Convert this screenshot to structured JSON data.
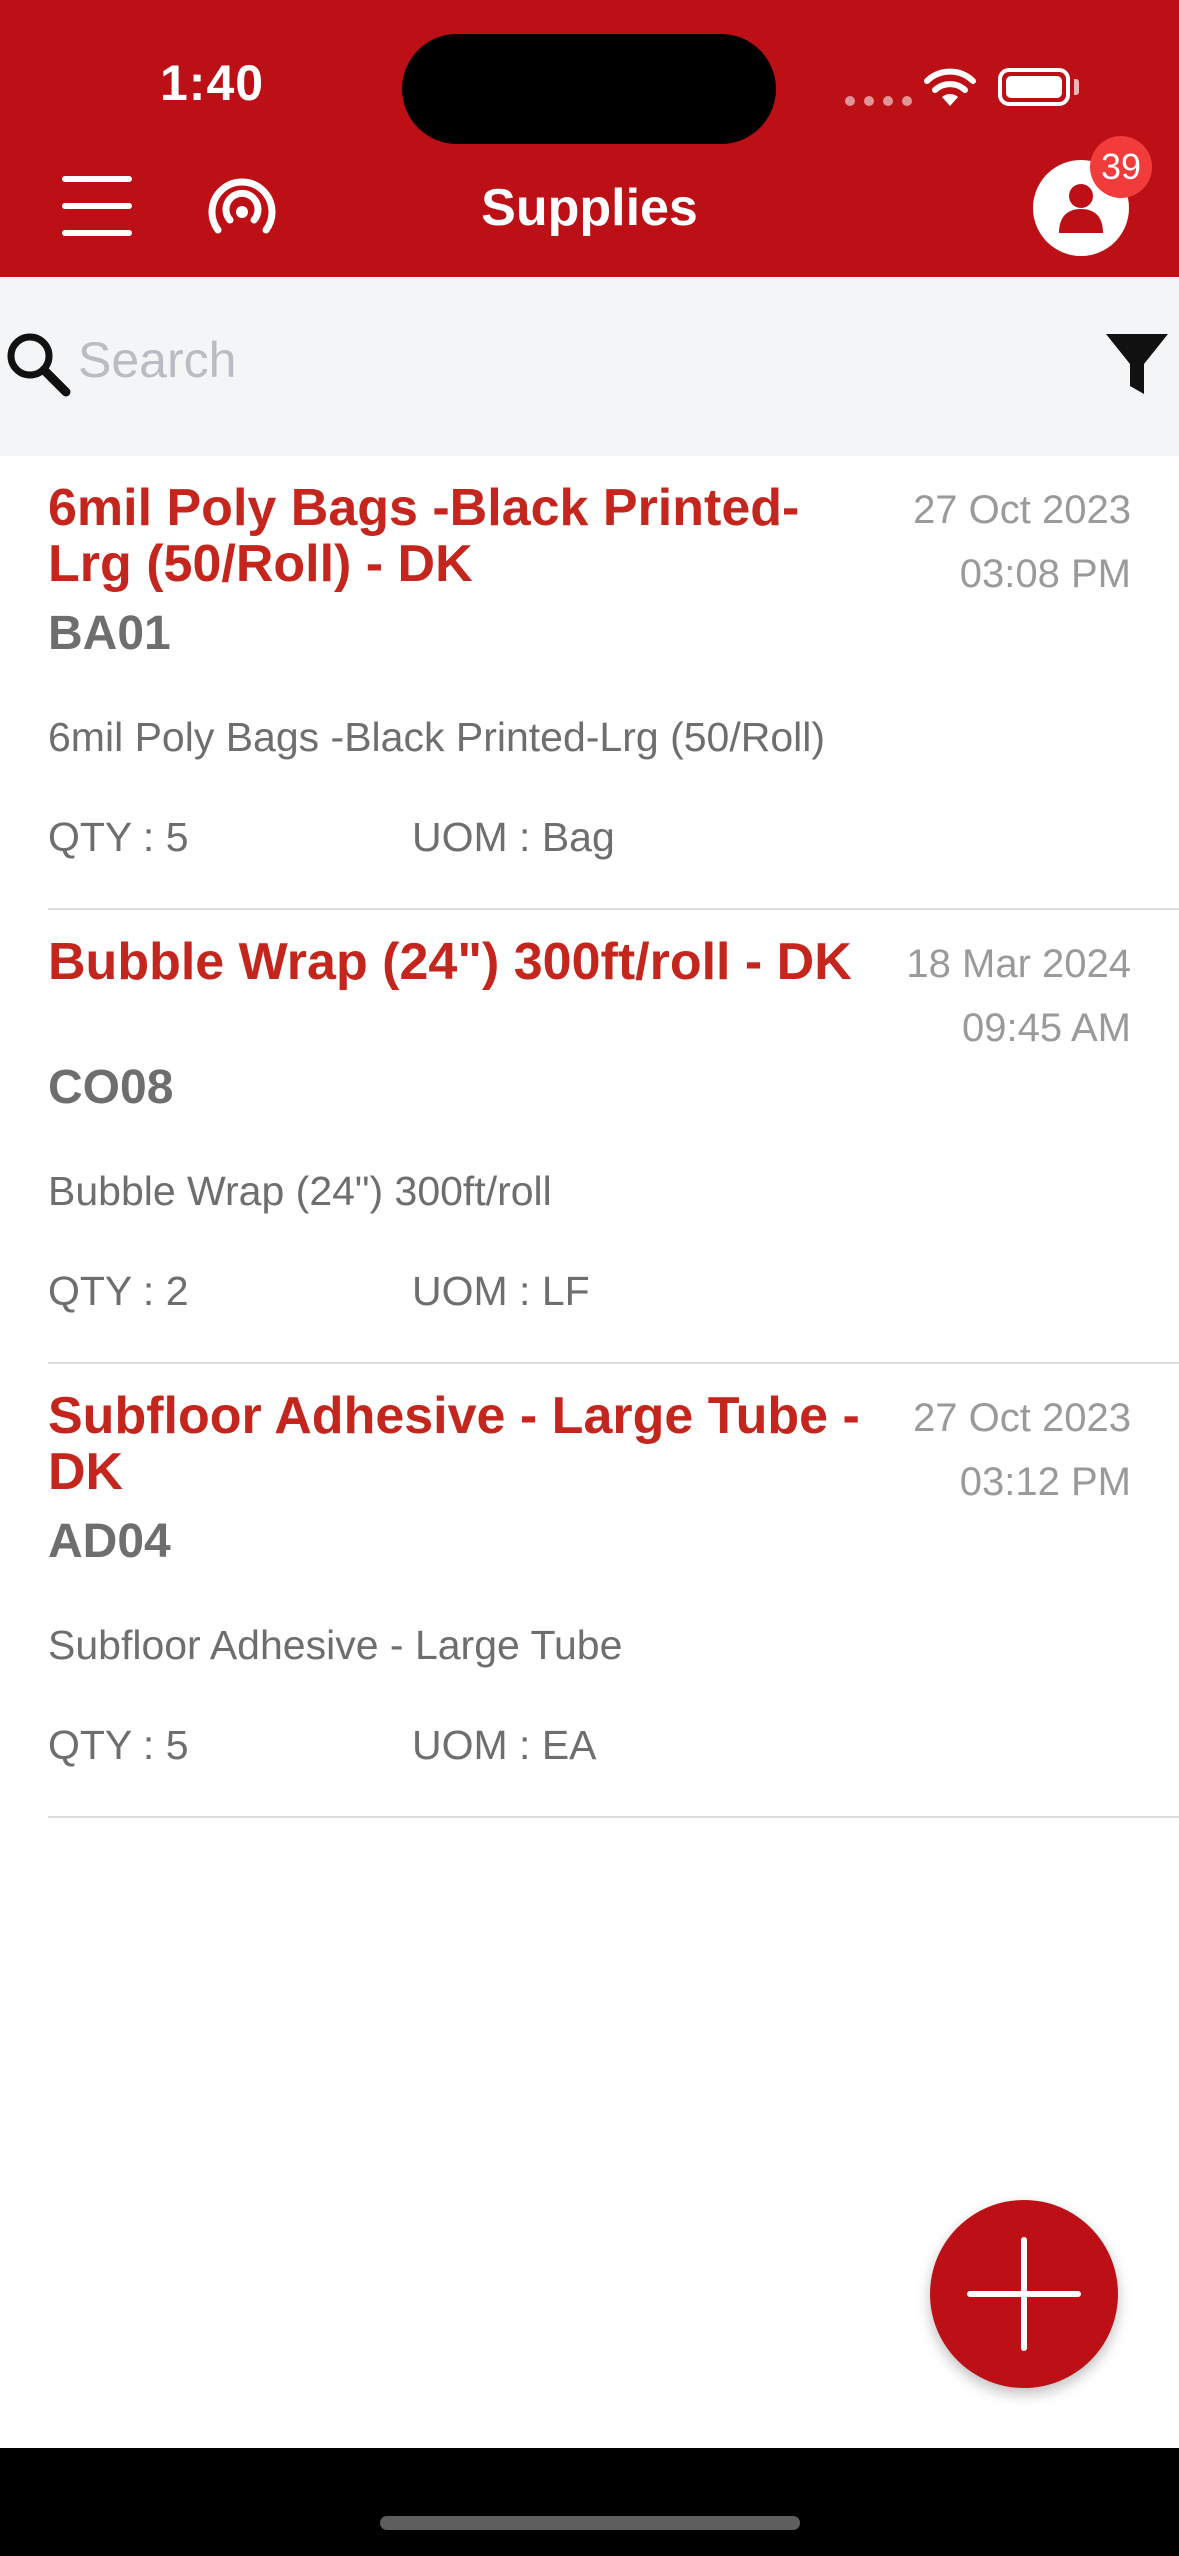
{
  "status_bar": {
    "time": "1:40"
  },
  "header": {
    "title": "Supplies",
    "notification_count": "39"
  },
  "search": {
    "placeholder": "Search",
    "value": ""
  },
  "items": [
    {
      "title": "6mil Poly Bags -Black Printed-Lrg (50/Roll) - DK",
      "date": "27 Oct 2023",
      "time": "03:08 PM",
      "code": "BA01",
      "description": "6mil Poly Bags -Black Printed-Lrg (50/Roll)",
      "qty": "QTY : 5",
      "uom": "UOM : Bag"
    },
    {
      "title": "Bubble Wrap (24\") 300ft/roll - DK",
      "date": "18 Mar 2024",
      "time": "09:45 AM",
      "code": "CO08",
      "description": "Bubble Wrap (24\") 300ft/roll",
      "qty": "QTY : 2",
      "uom": "UOM : LF"
    },
    {
      "title": "Subfloor Adhesive - Large Tube - DK",
      "date": "27 Oct 2023",
      "time": "03:12 PM",
      "code": "AD04",
      "description": "Subfloor Adhesive - Large Tube",
      "qty": "QTY : 5",
      "uom": "UOM : EA"
    }
  ],
  "icons": {
    "menu": "hamburger-menu-icon",
    "broadcast": "broadcast-icon",
    "profile": "user-icon",
    "search": "search-icon",
    "filter": "filter-icon",
    "add": "plus-icon"
  },
  "colors": {
    "brand": "#bd1016",
    "item_title": "#c4261d",
    "badge": "#f23b3b"
  }
}
